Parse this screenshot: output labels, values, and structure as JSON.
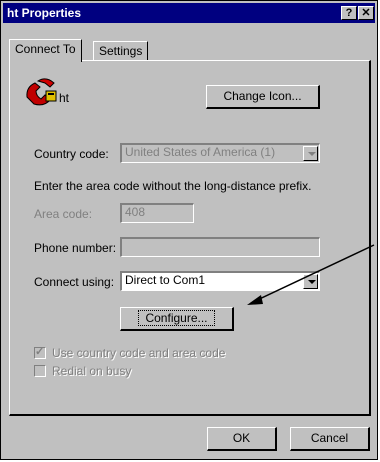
{
  "window": {
    "title": "ht Properties",
    "help_glyph": "?",
    "close_glyph": "✕"
  },
  "tabs": [
    {
      "label": "Connect To"
    },
    {
      "label": "Settings"
    }
  ],
  "connection": {
    "name": "ht",
    "icon": "phone-icon",
    "change_icon_label": "Change Icon..."
  },
  "form": {
    "country_label": "Country code:",
    "country_value": "United States of America (1)",
    "hint": "Enter the area code without the long-distance prefix.",
    "area_label": "Area code:",
    "area_value": "408",
    "phone_label": "Phone number:",
    "phone_value": "",
    "connect_label": "Connect using:",
    "connect_value": "Direct to Com1",
    "configure_label": "Configure...",
    "use_country_label": "Use country code and area code",
    "use_country_checked": true,
    "redial_label": "Redial on busy",
    "redial_checked": false
  },
  "buttons": {
    "ok": "OK",
    "cancel": "Cancel"
  }
}
